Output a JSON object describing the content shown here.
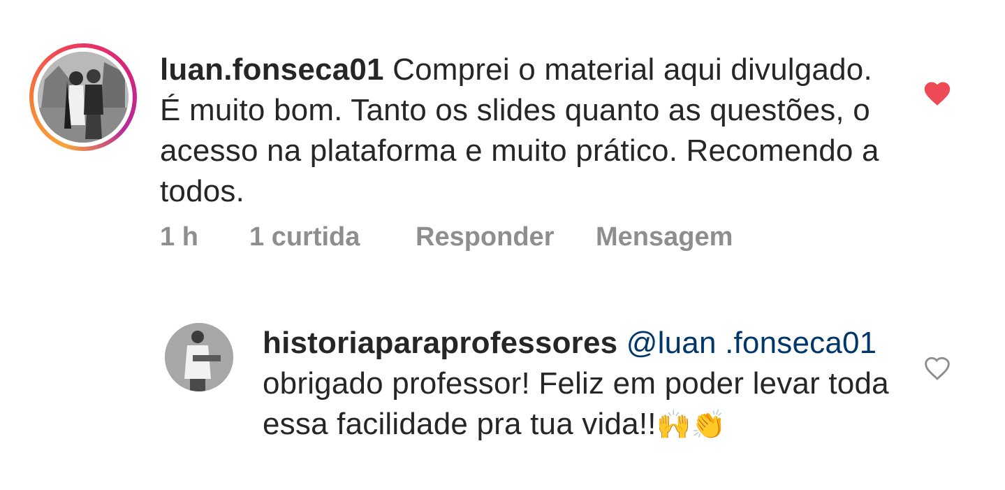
{
  "comment": {
    "username": "luan.fonseca01",
    "text": "Comprei o material aqui divulgado. É muito bom. Tanto os slides quanto as questões, o acesso na plataforma e muito prático.  Recomendo a todos.",
    "meta": {
      "time": "1 h",
      "likes": "1 curtida",
      "reply": "Responder",
      "message": "Mensagem"
    },
    "liked": true,
    "like_color": "#ed4956",
    "avatar_icon": "user-avatar-icon"
  },
  "reply": {
    "username": "historiaparaprofessores",
    "mention": "@luan .fonseca01",
    "text": "obrigado professor! Feliz em poder levar toda essa facilidade pra tua vida!!",
    "emojis": "🙌👏",
    "liked": false,
    "avatar_icon": "user-avatar-icon"
  },
  "colors": {
    "text": "#262626",
    "meta": "#8e8e8e",
    "mention": "#00376b",
    "heart_filled": "#ed4956",
    "heart_outline": "#8e8e8e"
  }
}
